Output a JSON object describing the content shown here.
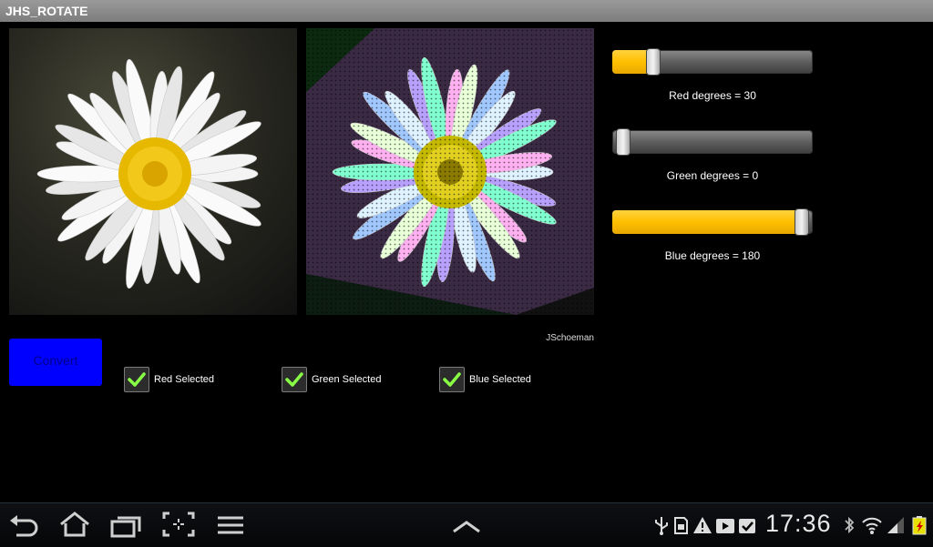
{
  "app": {
    "title": "JHS_ROTATE"
  },
  "sliders": [
    {
      "label": "Red degrees = 30",
      "value": 30,
      "max": 180
    },
    {
      "label": "Green degrees = 0",
      "value": 0,
      "max": 180
    },
    {
      "label": "Blue degrees = 180",
      "value": 180,
      "max": 180
    }
  ],
  "credit": "JSchoeman",
  "convert_label": "Convert",
  "checkboxes": [
    {
      "label": "Red Selected",
      "checked": true
    },
    {
      "label": "Green Selected",
      "checked": true
    },
    {
      "label": "Blue Selected",
      "checked": true
    }
  ],
  "status": {
    "time": "17:36"
  },
  "colors": {
    "slider_fill": "#ffbf00",
    "button": "#0000ff",
    "check": "#88ff44"
  }
}
